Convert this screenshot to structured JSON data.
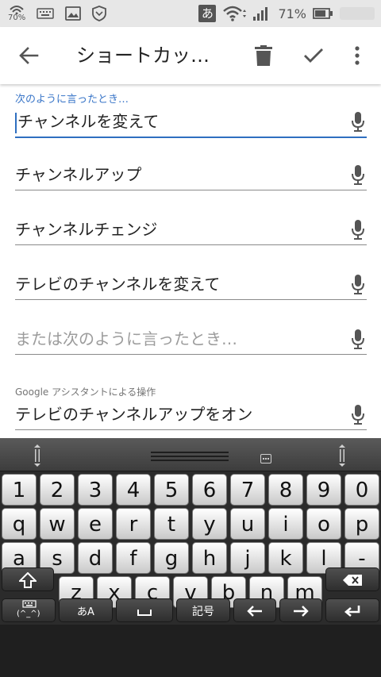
{
  "status_bar": {
    "network_speed": "70%",
    "battery_percent": "71%",
    "ime_indicator": "あ",
    "icons": [
      "wifi-speed-icon",
      "keyboard-icon",
      "image-icon",
      "shield-icon",
      "ime-icon",
      "wifi-icon",
      "signal-icon",
      "battery-icon"
    ]
  },
  "app_bar": {
    "title": "ショートカッ…",
    "icons": [
      "back-arrow-icon",
      "trash-icon",
      "check-icon",
      "more-vert-icon"
    ]
  },
  "form": {
    "floating_label": "次のように言ったとき…",
    "fields": [
      {
        "value": "チャンネルを変えて",
        "focused": true
      },
      {
        "value": "チャンネルアップ"
      },
      {
        "value": "チャンネルチェンジ"
      },
      {
        "value": "テレビのチャンネルを変えて"
      },
      {
        "placeholder": "または次のように言ったとき…"
      }
    ],
    "assistant_label": "Google アシスタントによる操作",
    "assistant_field": {
      "value": "テレビのチャンネルアップをオン"
    }
  },
  "keyboard": {
    "row_numbers": [
      "1",
      "2",
      "3",
      "4",
      "5",
      "6",
      "7",
      "8",
      "9",
      "0"
    ],
    "row_1": [
      "q",
      "w",
      "e",
      "r",
      "t",
      "y",
      "u",
      "i",
      "o",
      "p"
    ],
    "row_2": [
      "a",
      "s",
      "d",
      "f",
      "g",
      "h",
      "j",
      "k",
      "l",
      "-"
    ],
    "row_3": [
      "z",
      "x",
      "c",
      "v",
      "b",
      "n",
      "m"
    ],
    "input_mode_label": "あA",
    "symbols_label": "記号",
    "emoticon_label": "(^_^)",
    "colors": {
      "key_face": "#e8e8e8",
      "keyboard_bg": "#2b2b2b",
      "accent": "#2f6fc0"
    }
  }
}
